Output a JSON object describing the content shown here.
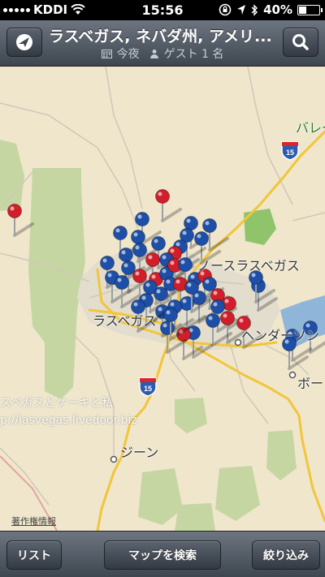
{
  "status_bar": {
    "carrier": "KDDI",
    "time": "15:56",
    "battery": "40%",
    "battery_level": 0.4
  },
  "nav": {
    "title": "ラスベガス, ネバダ州, アメリ...",
    "date_label": "今夜",
    "guests_label": "ゲスト 1 名"
  },
  "map": {
    "labels": {
      "north_las_vegas": "ノースラスベガス",
      "las_vegas": "ラスベガス",
      "henderson": "ヘンダーソン",
      "boulder": "ボー",
      "jean": "ジーン",
      "valley": "バレー"
    },
    "highway_shields": [
      "15",
      "15"
    ],
    "watermark_line1": "スベガスとケーキと私",
    "watermark_line2": "p://lasvegas.livedoor.biz",
    "legal_link": "著作権情報",
    "colors": {
      "blue_pin": "#1e4fa8",
      "red_pin": "#d21e2a",
      "land": "#efe6cc",
      "park": "#c5d6a3",
      "water": "#8fb6d9"
    }
  },
  "toolbar": {
    "list_label": "リスト",
    "search_map_label": "マップを検索",
    "filter_label": "絞り込み"
  }
}
